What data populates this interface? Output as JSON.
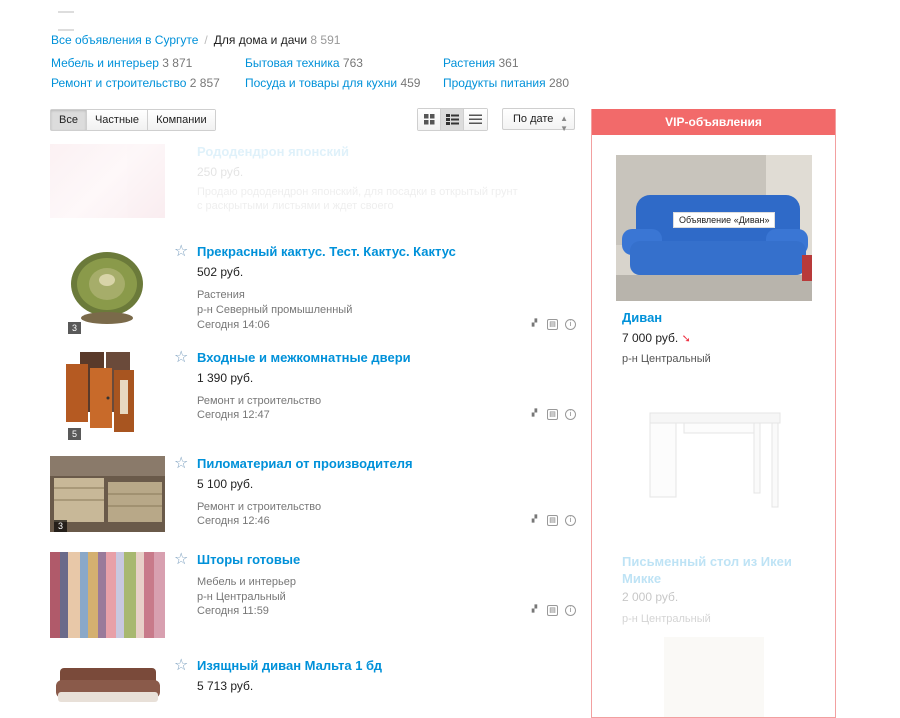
{
  "breadcrumb": {
    "root": "Все объявления в Сургуте",
    "sep": "/",
    "current": "Для дома и дачи",
    "count": "8 591"
  },
  "categories": [
    {
      "label": "Мебель и интерьер",
      "count": "3 871"
    },
    {
      "label": "Бытовая техника",
      "count": "763"
    },
    {
      "label": "Растения",
      "count": "361"
    },
    {
      "label": "Ремонт и строительство",
      "count": "2 857"
    },
    {
      "label": "Посуда и товары для кухни",
      "count": "459"
    },
    {
      "label": "Продукты питания",
      "count": "280"
    }
  ],
  "filters": [
    "Все",
    "Частные",
    "Компании"
  ],
  "sort": {
    "label": "По дате",
    "arrow": "▲▼"
  },
  "listings": [
    {
      "title": "Рододендрон японский",
      "price": "250 руб.",
      "desc": "Продаю рододендрон японский, для посадки в открытый грунт",
      "desc2": "с раскрытыми листьями и ждет своего",
      "meta1": "",
      "meta2": "",
      "date": "",
      "badge": ""
    },
    {
      "title": "Прекрасный кактус. Тест. Кактус. Кактус",
      "price": "502 руб.",
      "meta1": "Растения",
      "meta2": "р-н Северный промышленный",
      "date": "Сегодня 14:06",
      "badge": "3"
    },
    {
      "title": "Входные и межкомнатные двери",
      "price": "1 390 руб.",
      "meta1": "Ремонт и строительство",
      "meta2": "",
      "date": "Сегодня 12:47",
      "badge": "5"
    },
    {
      "title": "Пиломатериал от производителя",
      "price": "5 100 руб.",
      "meta1": "Ремонт и строительство",
      "meta2": "",
      "date": "Сегодня 12:46",
      "badge": "3"
    },
    {
      "title": "Шторы готовые",
      "price": "",
      "meta1": "Мебель и интерьер",
      "meta2": "р-н Центральный",
      "date": "Сегодня 11:59",
      "badge": ""
    },
    {
      "title": "Изящный диван Мальта 1 бд",
      "price": "5 713 руб.",
      "meta1": "",
      "meta2": "",
      "date": "",
      "badge": ""
    }
  ],
  "vip": {
    "header": "VIP-объявления",
    "tooltip": "Объявление «Диван»",
    "cards": [
      {
        "title": "Диван",
        "price": "7 000 руб.",
        "loc": "р-н Центральный"
      },
      {
        "title": "Письменный стол из Икеи Микке",
        "price": "2 000 руб.",
        "loc": "р-н Центральный"
      }
    ]
  },
  "colors": {
    "link": "#0091d9",
    "vip": "#f26a6a"
  }
}
